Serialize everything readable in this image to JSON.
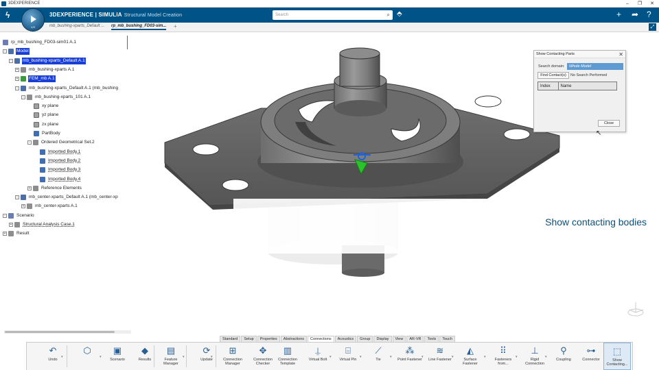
{
  "window": {
    "title": "3DEXPERIENCE"
  },
  "header": {
    "brand": "3DEXPERIENCE",
    "separator": " | ",
    "simulia": "SIMULIA",
    "app_name": "Structural Model Creation",
    "compass_version": "V,R",
    "search_placeholder": "Search",
    "accent": "#005386"
  },
  "tabs": [
    {
      "label": "mb_bushing-xparts_Default ...",
      "active": false
    },
    {
      "label": "rp_mb_bushing_FD03-sim...",
      "active": true
    }
  ],
  "tree": [
    {
      "label": "rp_mb_bushing_FD03-sim01 A.1",
      "depth": 0,
      "icon": "part",
      "selected": false,
      "toggle": ""
    },
    {
      "label": "Model",
      "depth": 0,
      "icon": "blue",
      "selected": true,
      "toggle": "-"
    },
    {
      "label": "mb_bushing-xparts_Default A.1",
      "depth": 1,
      "icon": "blue",
      "selected": true,
      "toggle": "-"
    },
    {
      "label": "mb_bushing-xparts A.1",
      "depth": 2,
      "icon": "gray",
      "selected": false,
      "toggle": "+"
    },
    {
      "label": "FEM_mb A.1",
      "depth": 2,
      "icon": "green",
      "selected": true,
      "toggle": "+"
    },
    {
      "label": "mb_bushing-xparts_Default A.1 (mb_bushing",
      "depth": 2,
      "icon": "blue",
      "selected": false,
      "toggle": "-"
    },
    {
      "label": "mb_bushing-xparts_101 A.1",
      "depth": 3,
      "icon": "gray",
      "selected": false,
      "toggle": "-"
    },
    {
      "label": "xy plane",
      "depth": 5,
      "icon": "grid",
      "selected": false,
      "toggle": ""
    },
    {
      "label": "yz plane",
      "depth": 5,
      "icon": "grid",
      "selected": false,
      "toggle": ""
    },
    {
      "label": "zx plane",
      "depth": 5,
      "icon": "grid",
      "selected": false,
      "toggle": ""
    },
    {
      "label": "PartBody",
      "depth": 5,
      "icon": "body",
      "selected": false,
      "toggle": ""
    },
    {
      "label": "Ordered Geometrical Set.2",
      "depth": 4,
      "icon": "gray",
      "selected": false,
      "toggle": "-"
    },
    {
      "label": "Imported Body.1",
      "depth": 6,
      "icon": "body",
      "selected": false,
      "toggle": ""
    },
    {
      "label": "Imported Body.2",
      "depth": 6,
      "icon": "body",
      "selected": false,
      "toggle": ""
    },
    {
      "label": "Imported Body.3",
      "depth": 6,
      "icon": "body",
      "selected": false,
      "toggle": ""
    },
    {
      "label": "Imported Body.4",
      "depth": 6,
      "icon": "body",
      "selected": false,
      "toggle": ""
    },
    {
      "label": "Reference Elements",
      "depth": 4,
      "icon": "gray",
      "selected": false,
      "toggle": "+"
    },
    {
      "label": "mb_center-xparts_Default A.1 (mb_center-xp",
      "depth": 2,
      "icon": "blue",
      "selected": false,
      "toggle": "-"
    },
    {
      "label": "mb_center-xparts A.1",
      "depth": 3,
      "icon": "gray",
      "selected": false,
      "toggle": "+"
    },
    {
      "label": "Scenario",
      "depth": 0,
      "icon": "part",
      "selected": false,
      "toggle": "-"
    },
    {
      "label": "Structural Analysis Case.1",
      "depth": 1,
      "icon": "gray",
      "selected": false,
      "toggle": "+"
    },
    {
      "label": "Result",
      "depth": 0,
      "icon": "gray",
      "selected": false,
      "toggle": "+"
    }
  ],
  "banner": {
    "text": "Show contacting bodies"
  },
  "dialog": {
    "title": "Show Contacting Parts",
    "search_domain_label": "Search domain:",
    "search_domain_value": "Whole Model",
    "find_button": "Find Contact(s)",
    "status": "No Search Performed",
    "columns": [
      "Index",
      "Name"
    ],
    "close_button": "Close"
  },
  "section_tabs": [
    "Standard",
    "Setup",
    "Properties",
    "Abstractions",
    "Connections",
    "Acoustics",
    "Group",
    "Display",
    "View",
    "AR-VR",
    "Tools",
    "Touch"
  ],
  "active_section": "Connections",
  "actions": [
    {
      "label": "Undo",
      "icon": "undo-icon",
      "glyph": "↶"
    },
    {
      "label": "",
      "icon": "model-icon",
      "glyph": "⬡"
    },
    {
      "label": "Scenario",
      "icon": "scenario-icon",
      "glyph": "▣"
    },
    {
      "label": "Results",
      "icon": "results-icon",
      "glyph": "◆"
    },
    {
      "label": "Feature Manager",
      "icon": "feature-manager-icon",
      "glyph": "▤"
    },
    {
      "label": "Update",
      "icon": "update-icon",
      "glyph": "⟳"
    },
    {
      "label": "Connection Manager",
      "icon": "connection-manager-icon",
      "glyph": "⊞"
    },
    {
      "label": "Connection Checker",
      "icon": "connection-checker-icon",
      "glyph": "✥"
    },
    {
      "label": "Connection Template",
      "icon": "connection-template-icon",
      "glyph": "▥"
    },
    {
      "label": "Virtual Bolt",
      "icon": "virtual-bolt-icon",
      "glyph": "⍊"
    },
    {
      "label": "Virtual Pin",
      "icon": "virtual-pin-icon",
      "glyph": "⌸"
    },
    {
      "label": "Tie",
      "icon": "tie-icon",
      "glyph": "⟋"
    },
    {
      "label": "Point Fastener",
      "icon": "point-fastener-icon",
      "glyph": "⁂"
    },
    {
      "label": "Line Fastener",
      "icon": "line-fastener-icon",
      "glyph": "≋"
    },
    {
      "label": "Surface Fastener",
      "icon": "surface-fastener-icon",
      "glyph": "◭"
    },
    {
      "label": "Fasteners from...",
      "icon": "fasteners-from-icon",
      "glyph": "⠿"
    },
    {
      "label": "Rigid Connection",
      "icon": "rigid-connection-icon",
      "glyph": "⊥"
    },
    {
      "label": "Coupling",
      "icon": "coupling-icon",
      "glyph": "⚲"
    },
    {
      "label": "Connector",
      "icon": "connector-icon",
      "glyph": "⊶"
    },
    {
      "label": "Show Contacting...",
      "icon": "show-contacting-icon",
      "glyph": "⬚"
    }
  ]
}
